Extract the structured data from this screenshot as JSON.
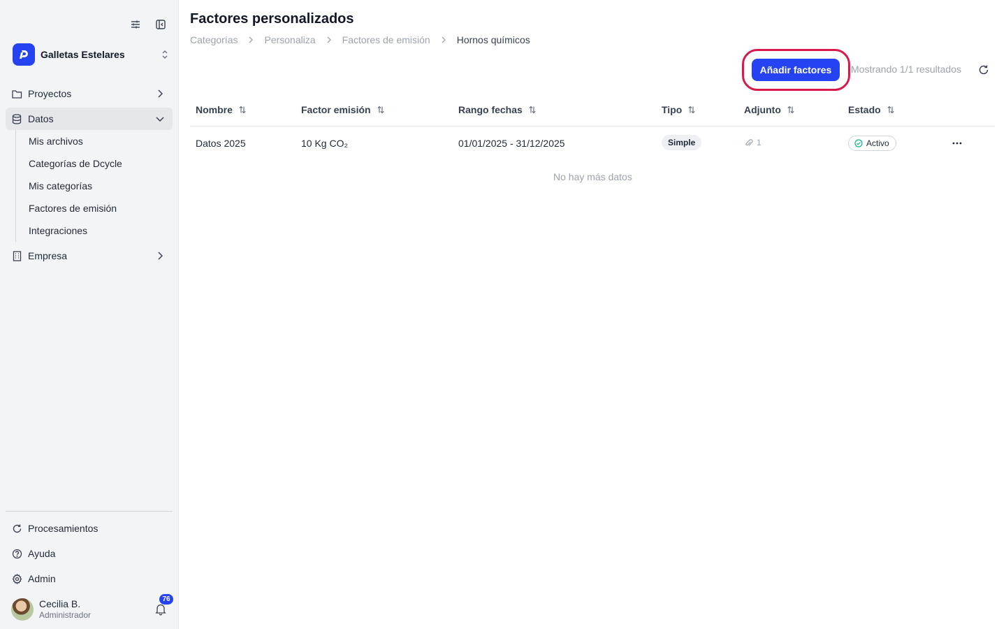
{
  "sidebar": {
    "org_name": "Galletas Estelares",
    "nav": [
      {
        "label": "Proyectos",
        "icon": "folder-icon",
        "expanded": false
      },
      {
        "label": "Datos",
        "icon": "database-icon",
        "expanded": true,
        "active": true
      },
      {
        "label": "Empresa",
        "icon": "building-icon",
        "expanded": false
      }
    ],
    "subnav": [
      "Mis archivos",
      "Categorías de Dcycle",
      "Mis categorías",
      "Factores de emisión",
      "Integraciones"
    ],
    "bottom": [
      {
        "label": "Procesamientos",
        "icon": "refresh-icon"
      },
      {
        "label": "Ayuda",
        "icon": "help-icon"
      },
      {
        "label": "Admin",
        "icon": "gear-icon"
      }
    ],
    "user": {
      "name": "Cecilia B.",
      "role": "Administrador",
      "notifications": "76"
    }
  },
  "header": {
    "title": "Factores personalizados",
    "breadcrumb": [
      "Categorías",
      "Personaliza",
      "Factores de emisión",
      "Hornos químicos"
    ]
  },
  "toolbar": {
    "add_label": "Añadir factores",
    "results_text": "Mostrando 1/1 resultados"
  },
  "table": {
    "columns": [
      "Nombre",
      "Factor emisión",
      "Rango fechas",
      "Tipo",
      "Adjunto",
      "Estado"
    ],
    "rows": [
      {
        "nombre": "Datos 2025",
        "factor": "10 Kg CO₂",
        "rango": "01/01/2025 - 31/12/2025",
        "tipo": "Simple",
        "adjunto": "1",
        "estado": "Activo"
      }
    ],
    "empty_note": "No hay más datos"
  },
  "colors": {
    "accent": "#2543f3",
    "highlight": "#d9184b",
    "status_ok": "#10b981"
  }
}
